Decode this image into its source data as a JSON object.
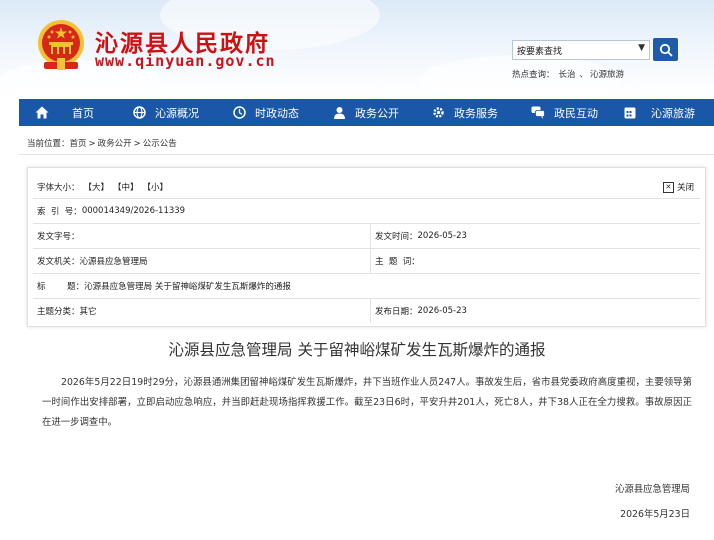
{
  "site": {
    "title": "沁源县人民政府",
    "url": "www.qinyuan.gov.cn"
  },
  "search": {
    "selected_option": "按要素查找",
    "hot_label": "热点查询：",
    "hot_items": [
      "长治",
      "沁源旅游"
    ]
  },
  "nav": [
    {
      "label": "首页",
      "icon": "home-icon"
    },
    {
      "label": "沁源概况",
      "icon": "globe-icon"
    },
    {
      "label": "时政动态",
      "icon": "clock-icon"
    },
    {
      "label": "政务公开",
      "icon": "person-icon"
    },
    {
      "label": "政务服务",
      "icon": "gear-icon"
    },
    {
      "label": "政民互动",
      "icon": "chat-icon"
    },
    {
      "label": "沁源旅游",
      "icon": "calendar-icon"
    }
  ],
  "breadcrumb": {
    "label": "当前位置：",
    "items": [
      "首页",
      "政务公开",
      "公示公告"
    ],
    "sep": ">"
  },
  "info": {
    "font_size_label": "字体大小：",
    "font_large": "【大】",
    "font_medium": "【中】",
    "font_small": "【小】",
    "close_label": "关闭",
    "index_label": "索  引  号：",
    "index_value": "000014349/2026-11339",
    "doc_no_label": "发文字号：",
    "doc_no_value": "",
    "doc_time_label": "发文时间：",
    "doc_time_value": "2026-05-23",
    "issuer_label": "发文机关：",
    "issuer_value": "沁源县应急管理局",
    "subject_label": "主  题  词：",
    "subject_value": "",
    "title_label": "标        题：",
    "title_value": "沁源县应急管理局 关于留神峪煤矿发生瓦斯爆炸的通报",
    "category_label": "主题分类：",
    "category_value": "其它",
    "publish_label": "发布日期：",
    "publish_value": "2026-05-23"
  },
  "article": {
    "title": "沁源县应急管理局 关于留神峪煤矿发生瓦斯爆炸的通报",
    "body": "2026年5月22日19时29分，沁源县通洲集团留神峪煤矿发生瓦斯爆炸，井下当班作业人员247人。事故发生后，省市县党委政府高度重视，主要领导第一时间作出安排部署，立即启动应急响应，并当即赶赴现场指挥救援工作。截至23日6时，平安升井201人，死亡8人，井下38人正在全力搜救。事故原因正在进一步调查中。",
    "signature": "沁源县应急管理局",
    "date": "2026年5月23日"
  },
  "colors": {
    "nav_bg": "#1a57a8",
    "title_red": "#d01010",
    "search_btn": "#1f5ca8"
  }
}
